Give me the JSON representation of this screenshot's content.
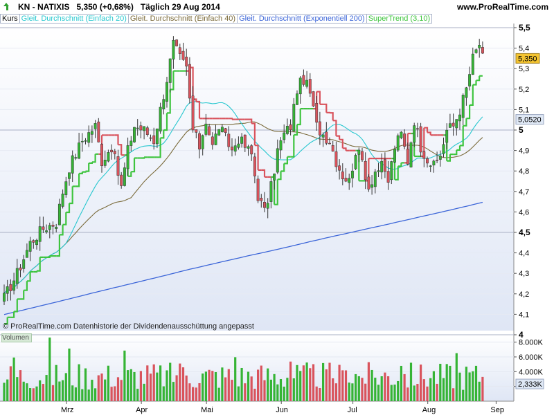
{
  "header": {
    "symbol_title": "KN - NATIXIS",
    "price_change": "5,350 (+0,68%)",
    "period_date": "Täglich  29 Aug 2014",
    "website": "www.ProRealTime.com"
  },
  "legend": {
    "items": [
      {
        "label": "Kurs",
        "color": "#000000"
      },
      {
        "label": "Gleit. Durchschnitt (Einfach 20)",
        "color": "#27c7cf"
      },
      {
        "label": "Gleit. Durchschnitt (Einfach 40)",
        "color": "#7a6a3a"
      },
      {
        "label": "Gleit. Durchschnitt (Exponentiell 200)",
        "color": "#3a64d8"
      },
      {
        "label": "SuperTrend (3,10)",
        "color": "#3ec43e"
      }
    ]
  },
  "footer": {
    "copyright": "© ProRealTime.com  Datenhistorie der Dividendenausschüttung angepasst",
    "volume_label": "Volumen"
  },
  "colors": {
    "up": "#35b435",
    "down": "#d9535c",
    "sma20": "#27c7cf",
    "sma40": "#7a6a3a",
    "ema200": "#3a64d8",
    "supertrend_up": "#3ec43e",
    "supertrend_down": "#d9535c",
    "price_tag": "#f4c430",
    "value_tag": "#dfe8f5"
  },
  "chart_data": [
    {
      "type": "candlestick",
      "title": "KN - NATIXIS",
      "y_ticks": [
        "4",
        "4,1",
        "4,2",
        "4,3",
        "4,4",
        "4,5",
        "4,6",
        "4,7",
        "4,8",
        "4,9",
        "5",
        "5,1",
        "5,2",
        "5,3",
        "5,4",
        "5,5"
      ],
      "bold_ticks": [
        "4",
        "4,5",
        "5",
        "5,5"
      ],
      "ylim": [
        4.0,
        5.5
      ],
      "x_ticks": [
        "Mrz",
        "Apr",
        "Mai",
        "Jun",
        "Jul",
        "Aug",
        "Sep"
      ],
      "current_price_label": "5,350",
      "current_price": 5.35,
      "supertrend_label": "5,0520",
      "supertrend_value": 5.052,
      "price_anchors": [
        [
          0,
          4.18
        ],
        [
          4,
          4.3
        ],
        [
          8,
          4.45
        ],
        [
          12,
          4.52
        ],
        [
          16,
          4.55
        ],
        [
          18,
          4.7
        ],
        [
          20,
          4.82
        ],
        [
          24,
          4.95
        ],
        [
          28,
          5.02
        ],
        [
          30,
          4.85
        ],
        [
          33,
          4.92
        ],
        [
          36,
          4.72
        ],
        [
          38,
          4.9
        ],
        [
          40,
          5.02
        ],
        [
          43,
          5.0
        ],
        [
          46,
          4.95
        ],
        [
          50,
          5.25
        ],
        [
          52,
          5.42
        ],
        [
          54,
          5.35
        ],
        [
          56,
          5.3
        ],
        [
          58,
          5.0
        ],
        [
          60,
          4.92
        ],
        [
          62,
          5.05
        ],
        [
          64,
          4.92
        ],
        [
          66,
          5.02
        ],
        [
          70,
          4.9
        ],
        [
          72,
          4.96
        ],
        [
          74,
          4.92
        ],
        [
          76,
          4.88
        ],
        [
          78,
          4.68
        ],
        [
          80,
          4.6
        ],
        [
          82,
          4.72
        ],
        [
          84,
          4.9
        ],
        [
          86,
          4.98
        ],
        [
          88,
          5.02
        ],
        [
          90,
          5.2
        ],
        [
          92,
          5.25
        ],
        [
          94,
          5.18
        ],
        [
          96,
          5.02
        ],
        [
          98,
          4.98
        ],
        [
          100,
          4.95
        ],
        [
          102,
          4.85
        ],
        [
          104,
          4.78
        ],
        [
          106,
          4.75
        ],
        [
          108,
          4.9
        ],
        [
          110,
          4.85
        ],
        [
          112,
          4.72
        ],
        [
          114,
          4.8
        ],
        [
          116,
          4.82
        ],
        [
          118,
          4.75
        ],
        [
          120,
          4.92
        ],
        [
          122,
          4.98
        ],
        [
          124,
          4.85
        ],
        [
          126,
          5.05
        ],
        [
          128,
          4.92
        ],
        [
          130,
          4.86
        ],
        [
          132,
          4.82
        ],
        [
          134,
          4.88
        ],
        [
          136,
          5.0
        ],
        [
          138,
          5.02
        ],
        [
          140,
          5.1
        ],
        [
          142,
          5.2
        ],
        [
          144,
          5.35
        ],
        [
          146,
          5.42
        ],
        [
          147,
          5.35
        ]
      ],
      "volume": {
        "y_ticks": [
          "2.000K",
          "4.000K",
          "6.000K",
          "8.000K"
        ],
        "ylim": [
          0,
          9000
        ],
        "current_label": "2,333K",
        "current_value": 2333
      }
    }
  ]
}
